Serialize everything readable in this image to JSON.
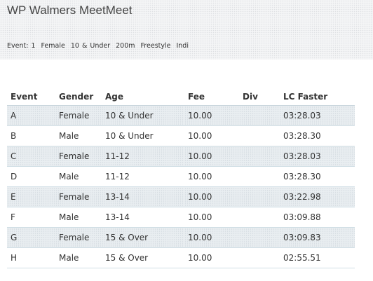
{
  "page": {
    "title": "WP Walmers MeetMeet",
    "subtitle": {
      "event": "Event: 1",
      "gender": "Female",
      "age": "10 & Under",
      "distance": "200m",
      "stroke": "Freestyle",
      "type": "Indi"
    }
  },
  "table": {
    "headers": {
      "event": "Event",
      "gender": "Gender",
      "age": "Age",
      "fee": "Fee",
      "div": "Div",
      "lc_faster": "LC Faster"
    },
    "rows": [
      {
        "event": "A",
        "gender": "Female",
        "age": "10 & Under",
        "fee": "10.00",
        "div": "",
        "lc_faster": "03:28.03"
      },
      {
        "event": "B",
        "gender": "Male",
        "age": "10 & Under",
        "fee": "10.00",
        "div": "",
        "lc_faster": "03:28.30"
      },
      {
        "event": "C",
        "gender": "Female",
        "age": "11-12",
        "fee": "10.00",
        "div": "",
        "lc_faster": "03:28.03"
      },
      {
        "event": "D",
        "gender": "Male",
        "age": "11-12",
        "fee": "10.00",
        "div": "",
        "lc_faster": "03:28.30"
      },
      {
        "event": "E",
        "gender": "Female",
        "age": "13-14",
        "fee": "10.00",
        "div": "",
        "lc_faster": "03:22.98"
      },
      {
        "event": "F",
        "gender": "Male",
        "age": "13-14",
        "fee": "10.00",
        "div": "",
        "lc_faster": "03:09.88"
      },
      {
        "event": "G",
        "gender": "Female",
        "age": "15 & Over",
        "fee": "10.00",
        "div": "",
        "lc_faster": "03:09.83"
      },
      {
        "event": "H",
        "gender": "Male",
        "age": "15 & Over",
        "fee": "10.00",
        "div": "",
        "lc_faster": "02:55.51"
      }
    ]
  },
  "colors": {
    "header_band": "#f4f5f6",
    "shaded_row": "#e9eef1",
    "row_border": "#cfdde4",
    "text": "#333333"
  }
}
